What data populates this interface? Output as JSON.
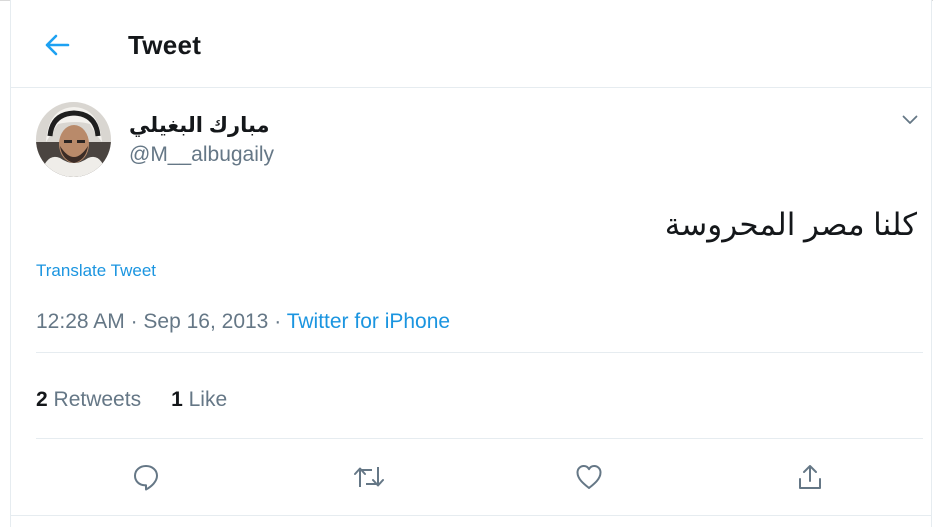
{
  "header": {
    "title": "Tweet",
    "back_icon": "arrow-left-icon"
  },
  "author": {
    "display_name": "مبارك البغيلي",
    "handle": "@M__albugaily",
    "avatar_icon": "user-avatar"
  },
  "tweet": {
    "text": "كلنا مصر المحروسة",
    "translate_label": "Translate Tweet",
    "time": "12:28 AM",
    "date": "Sep 16, 2013",
    "separator": "·",
    "source": "Twitter for iPhone"
  },
  "stats": {
    "retweets_count": "2",
    "retweets_label": "Retweets",
    "likes_count": "1",
    "likes_label": "Like"
  },
  "actions": {
    "reply_icon": "reply-icon",
    "retweet_icon": "retweet-icon",
    "like_icon": "heart-icon",
    "share_icon": "share-icon"
  },
  "colors": {
    "accent": "#1da1f2",
    "link": "#1b95e0",
    "text_primary": "#14171a",
    "text_secondary": "#657786",
    "border": "#e6ecf0"
  }
}
